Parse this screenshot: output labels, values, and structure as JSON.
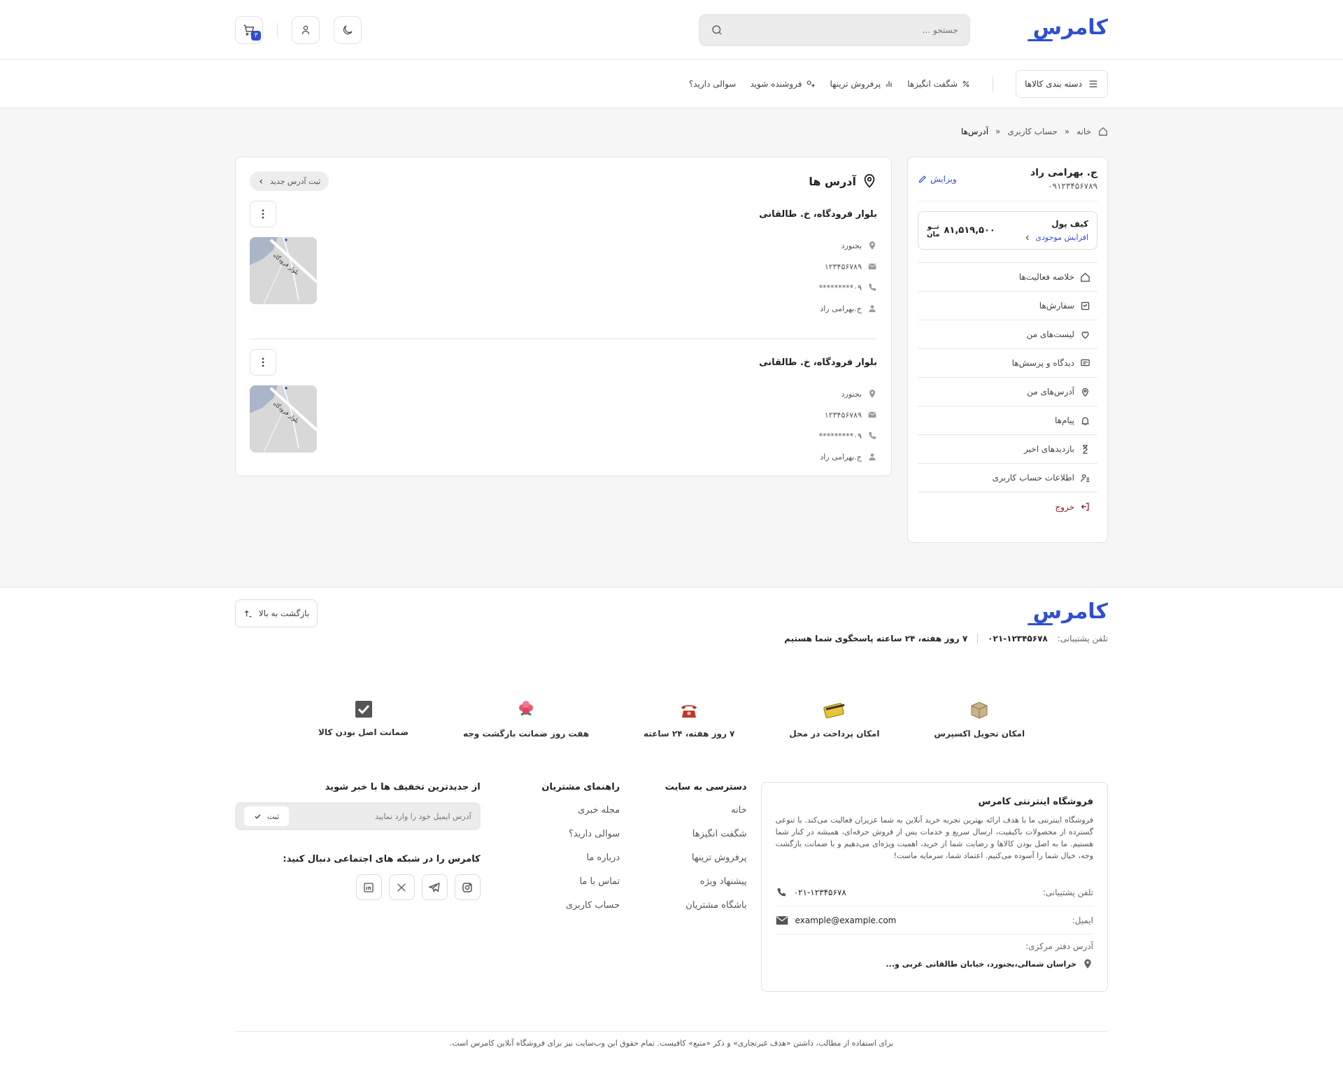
{
  "brand": {
    "logo": "کامرس",
    "accent": "#2f4fd1"
  },
  "header": {
    "search_placeholder": "جستجو ...",
    "cart_count": "۳"
  },
  "nav": {
    "categories": "دسته بندی کالاها",
    "links": [
      "شگفت انگیزها",
      "پرفروش ترینها",
      "فروشنده شوید",
      "سوالی دارید؟"
    ]
  },
  "breadcrumb": [
    "خانه",
    "حساب کاربری",
    "آدرس‌ها"
  ],
  "profile": {
    "name": "ج. بهرامی راد",
    "phone": "۰۹۱۲۳۴۵۶۷۸۹",
    "edit": "ویرایش",
    "wallet_title": "کیف پول",
    "wallet_increase": "افزایش موجودی",
    "wallet_amount": "۸۱,۵۱۹,۵۰۰",
    "wallet_unit_top": "تــو",
    "wallet_unit_bottom": "مان"
  },
  "menu": [
    "خلاصه فعالیت‌ها",
    "سفارش‌ها",
    "لیست‌های من",
    "دیدگاه و پرسش‌ها",
    "آدرس‌های من",
    "پیام‌ها",
    "بازدیدهای اخیر",
    "اطلاعات حساب کاربری",
    "خروج"
  ],
  "addresses_card": {
    "title": "آدرس ها",
    "new_button": "ثبت آدرس جدید",
    "items": [
      {
        "title": "بلوار فرودگاه، خ. طالقانی",
        "city": "بجنورد",
        "postal": "۱۲۳۴۵۶۷۸۹",
        "phone": "۰۹*********",
        "recipient": "ج.بهرامی راد",
        "map_label": "بلوار فرودگاه"
      },
      {
        "title": "بلوار فرودگاه، خ. طالقانی",
        "city": "بجنورد",
        "postal": "۱۲۳۴۵۶۷۸۹",
        "phone": "۰۹*********",
        "recipient": "ج.بهرامی راد",
        "map_label": "بلوار فرودگاه"
      }
    ]
  },
  "footer": {
    "back_to_top": "بازگشت به بالا",
    "support_label": "تلفن پشتیبانی:",
    "support_phone": "۰۲۱-۱۲۳۴۵۶۷۸",
    "support_hours": "۷ روز هفته، ۲۴ ساعته پاسخگوی شما هستیم",
    "features": [
      "امکان تحویل اکسپرس",
      "امکان پرداخت در محل",
      "۷ روز هفته، ۲۴ ساعته",
      "هفت روز ضمانت بازگشت وجه",
      "ضمانت اصل بودن کالا"
    ],
    "about_title": "فروشگاه اینترنتی کامرس",
    "about_text": "فروشگاه اینترنتی ما با هدف ارائه بهترین تجربه خرید آنلاین به شما عزیزان فعالیت می‌کند. با تنوعی گسترده از محصولات باکیفیت، ارسال سریع و خدمات پس از فروش حرفه‌ای، همیشه در کنار شما هستیم. ما به اصل بودن کالاها و رضایت شما از خرید، اهمیت ویژه‌ای می‌دهیم و با ضمانت بازگشت وجه، خیال شما را آسوده می‌کنیم. اعتماد شما، سرمایه ماست!",
    "phone_label": "تلفن پشتیبانی:",
    "phone_value": "۰۲۱-۱۲۳۴۵۶۷۸",
    "email_label": "ایمیل:",
    "email_value": "example@example.com",
    "office_label": "آدرس دفتر مرکزی:",
    "office_value": "خراسان شمالی،بجنورد، خیابان طالقانی غربی و...",
    "col1_title": "دسترسی به سایت",
    "col1_links": [
      "خانه",
      "شگفت انگیزها",
      "پرفروش ترینها",
      "پیشنهاد ویژه",
      "باشگاه مشتریان"
    ],
    "col2_title": "راهنمای مشتریان",
    "col2_links": [
      "مجله خبری",
      "سوالی دارید؟",
      "درباره ما",
      "تماس با ما",
      "حساب کاربری"
    ],
    "news_title": "از جدیدترین تخفیف ها با خبر شوید",
    "email_placeholder": "آدرس ایمیل خود را وارد نمایید",
    "submit": "ثبت",
    "social_title": "کامرس را در شبکه های اجتماعی دنبال کنید:",
    "copyright": "برای استفاده از مطالب، داشتن «هدف غیرتجاری» و ذکر «منبع» کافیست. تمام حقوق این وب‌سایت نیز برای فروشگاه آنلاین کامرس است."
  }
}
